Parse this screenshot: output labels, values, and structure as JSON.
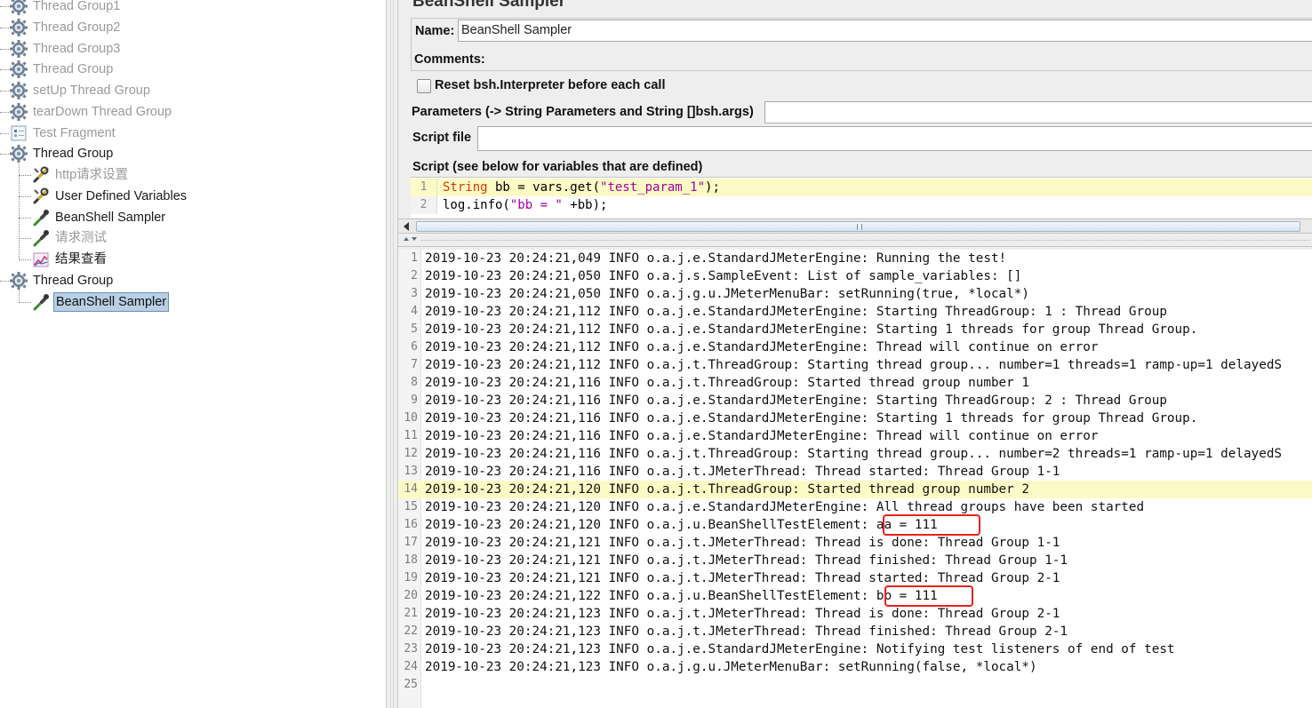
{
  "tree": {
    "items": [
      {
        "label": "Thread Group1",
        "state": "disabled",
        "icon": "gear-icon"
      },
      {
        "label": "Thread Group2",
        "state": "disabled",
        "icon": "gear-icon"
      },
      {
        "label": "Thread Group3",
        "state": "disabled",
        "icon": "gear-icon"
      },
      {
        "label": "Thread Group",
        "state": "disabled",
        "icon": "gear-icon"
      },
      {
        "label": "setUp Thread Group",
        "state": "disabled",
        "icon": "gear-icon"
      },
      {
        "label": "tearDown Thread Group",
        "state": "disabled",
        "icon": "gear-icon"
      },
      {
        "label": "Test Fragment",
        "state": "disabled",
        "icon": "fragment-icon"
      },
      {
        "label": "Thread Group",
        "state": "enabled",
        "icon": "gear-icon"
      },
      {
        "label": "http请求设置",
        "state": "disabled",
        "icon": "wrench-icon"
      },
      {
        "label": "User Defined Variables",
        "state": "enabled",
        "icon": "wrench-icon"
      },
      {
        "label": "BeanShell Sampler",
        "state": "enabled",
        "icon": "pipette-icon"
      },
      {
        "label": "请求测试",
        "state": "disabled",
        "icon": "pipette-icon"
      },
      {
        "label": "结果查看",
        "state": "enabled",
        "icon": "graph-icon"
      },
      {
        "label": "Thread Group",
        "state": "enabled",
        "icon": "gear-icon"
      },
      {
        "label": "BeanShell Sampler",
        "state": "selected",
        "icon": "pipette-icon"
      }
    ]
  },
  "panel": {
    "title": "BeanShell Sampler",
    "name_label": "Name:",
    "name_value": "BeanShell Sampler",
    "comments_label": "Comments:",
    "reset_label": "Reset bsh.Interpreter before each call",
    "params_label": "Parameters (-> String Parameters and String []bsh.args)",
    "params_value": "",
    "script_file_label": "Script file",
    "script_file_value": "",
    "script_label": "Script (see below for variables that are defined)"
  },
  "script": {
    "lines": [
      {
        "num": "1",
        "parts": [
          [
            "String",
            "kw"
          ],
          [
            " bb = vars.get(",
            ""
          ],
          [
            "\"test_param_1\"",
            "str"
          ],
          [
            ");",
            ""
          ]
        ]
      },
      {
        "num": "2",
        "parts": [
          [
            "log.info(",
            ""
          ],
          [
            "\"bb = \"",
            "str"
          ],
          [
            " +bb);",
            ""
          ]
        ]
      }
    ]
  },
  "log": {
    "lines": [
      "2019-10-23 20:24:21,049 INFO o.a.j.e.StandardJMeterEngine: Running the test!",
      "2019-10-23 20:24:21,050 INFO o.a.j.s.SampleEvent: List of sample_variables: []",
      "2019-10-23 20:24:21,050 INFO o.a.j.g.u.JMeterMenuBar: setRunning(true, *local*)",
      "2019-10-23 20:24:21,112 INFO o.a.j.e.StandardJMeterEngine: Starting ThreadGroup: 1 : Thread Group",
      "2019-10-23 20:24:21,112 INFO o.a.j.e.StandardJMeterEngine: Starting 1 threads for group Thread Group.",
      "2019-10-23 20:24:21,112 INFO o.a.j.e.StandardJMeterEngine: Thread will continue on error",
      "2019-10-23 20:24:21,112 INFO o.a.j.t.ThreadGroup: Starting thread group... number=1 threads=1 ramp-up=1 delayedS",
      "2019-10-23 20:24:21,116 INFO o.a.j.t.ThreadGroup: Started thread group number 1",
      "2019-10-23 20:24:21,116 INFO o.a.j.e.StandardJMeterEngine: Starting ThreadGroup: 2 : Thread Group",
      "2019-10-23 20:24:21,116 INFO o.a.j.e.StandardJMeterEngine: Starting 1 threads for group Thread Group.",
      "2019-10-23 20:24:21,116 INFO o.a.j.e.StandardJMeterEngine: Thread will continue on error",
      "2019-10-23 20:24:21,116 INFO o.a.j.t.ThreadGroup: Starting thread group... number=2 threads=1 ramp-up=1 delayedS",
      "2019-10-23 20:24:21,116 INFO o.a.j.t.JMeterThread: Thread started: Thread Group 1-1",
      "2019-10-23 20:24:21,120 INFO o.a.j.t.ThreadGroup: Started thread group number 2",
      "2019-10-23 20:24:21,120 INFO o.a.j.e.StandardJMeterEngine: All thread groups have been started",
      "2019-10-23 20:24:21,120 INFO o.a.j.u.BeanShellTestElement: aa = 111",
      "2019-10-23 20:24:21,121 INFO o.a.j.t.JMeterThread: Thread is done: Thread Group 1-1",
      "2019-10-23 20:24:21,121 INFO o.a.j.t.JMeterThread: Thread finished: Thread Group 1-1",
      "2019-10-23 20:24:21,121 INFO o.a.j.t.JMeterThread: Thread started: Thread Group 2-1",
      "2019-10-23 20:24:21,122 INFO o.a.j.u.BeanShellTestElement: bb = 111",
      "2019-10-23 20:24:21,123 INFO o.a.j.t.JMeterThread: Thread is done: Thread Group 2-1",
      "2019-10-23 20:24:21,123 INFO o.a.j.t.JMeterThread: Thread finished: Thread Group 2-1",
      "2019-10-23 20:24:21,123 INFO o.a.j.e.StandardJMeterEngine: Notifying test listeners of end of test",
      "2019-10-23 20:24:21,123 INFO o.a.j.g.u.JMeterMenuBar: setRunning(false, *local*)",
      ""
    ],
    "highlighted_line": 14,
    "marked_lines": [
      16,
      20
    ]
  },
  "colors": {
    "selection": "#b8cfe5",
    "line_highlight": "#fcfbc6",
    "annotation_red": "#e8211d",
    "keyword": "#d13b00",
    "string": "#a3009b"
  }
}
